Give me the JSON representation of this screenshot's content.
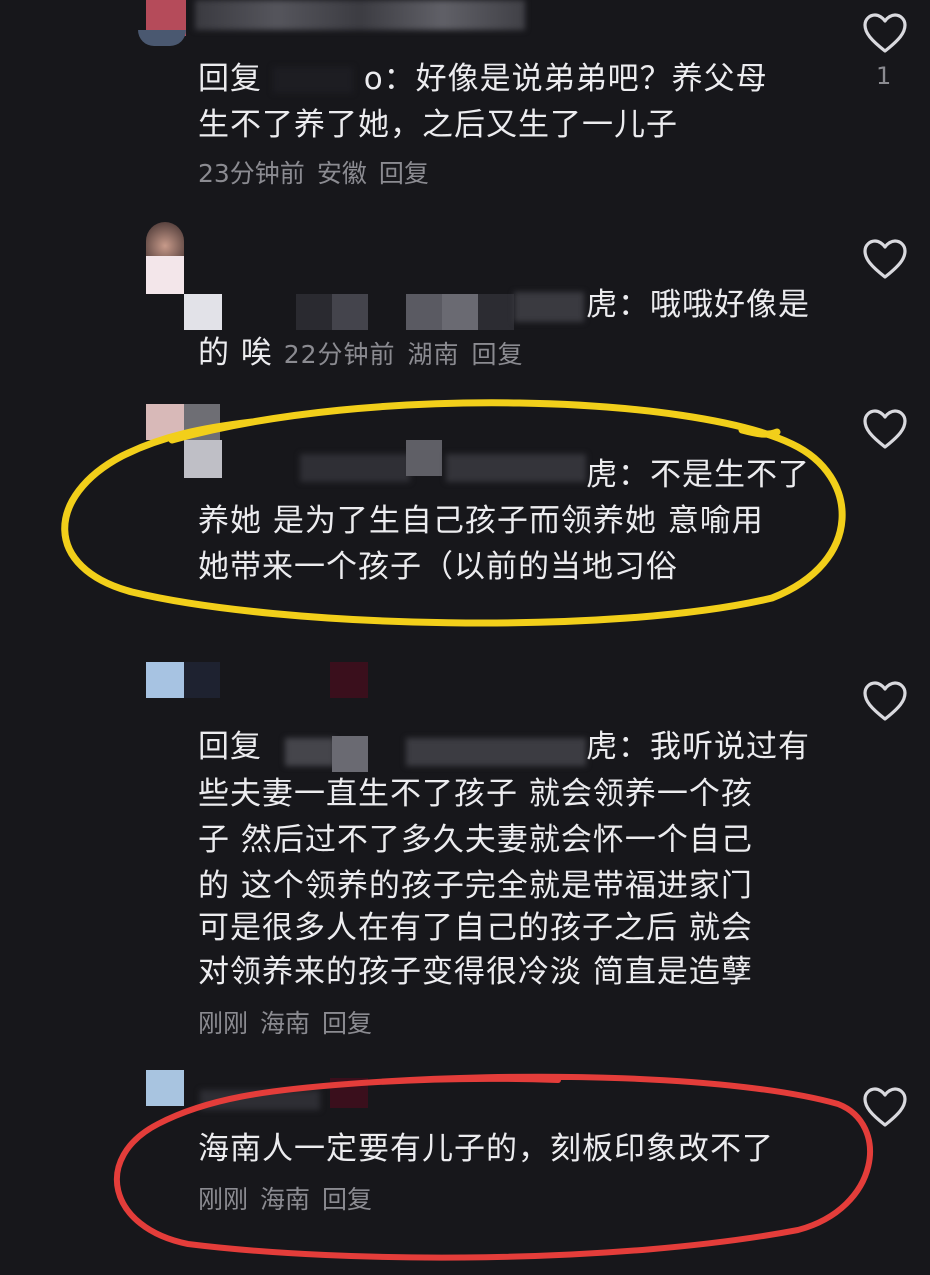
{
  "comments": [
    {
      "lines": [
        "回复",
        "o：好像是说弟弟吧？养父母",
        "生不了养了她，之后又生了一儿子"
      ],
      "time": "23分钟前",
      "location": "安徽",
      "reply": "回复",
      "likes": "1"
    },
    {
      "lines": [
        "虎：哦哦好像是",
        "的 唉"
      ],
      "time": "22分钟前",
      "location": "湖南",
      "reply": "回复"
    },
    {
      "lines": [
        "虎：不是生不了",
        "养她 是为了生自己孩子而领养她 意喻用",
        "她带来一个孩子（以前的当地习俗"
      ]
    },
    {
      "lines": [
        "回复",
        "虎：我听说过有",
        "些夫妻一直生不了孩子 就会领养一个孩",
        "子 然后过不了多久夫妻就会怀一个自己",
        "的 这个领养的孩子完全就是带福进家门",
        "可是很多人在有了自己的孩子之后 就会",
        "对领养来的孩子变得很冷淡 简直是造孽"
      ],
      "time": "刚刚",
      "location": "海南",
      "reply": "回复"
    },
    {
      "lines": [
        "海南人一定要有儿子的，刻板印象改不了"
      ],
      "time": "刚刚",
      "location": "海南",
      "reply": "回复"
    }
  ],
  "colors": {
    "background": "#17171b",
    "text": "#ececef",
    "meta": "#8b8b91",
    "highlight_yellow": "#f2cf1a",
    "highlight_red": "#e43d3a"
  },
  "icons": {
    "like": "heart-outline-icon"
  }
}
